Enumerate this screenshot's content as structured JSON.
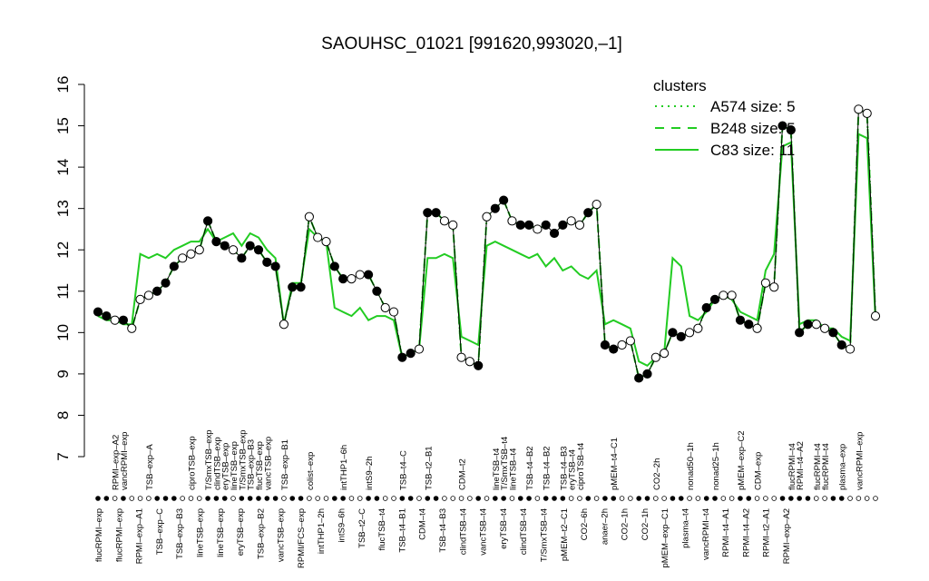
{
  "chart_data": {
    "type": "line",
    "title": "SAOUHSC_01021 [991620,993020,–1]",
    "xlabel": "",
    "ylabel": "",
    "ylim": [
      7,
      16
    ],
    "yticks": [
      7,
      8,
      9,
      10,
      11,
      12,
      13,
      14,
      15,
      16
    ],
    "grid": false,
    "legend": {
      "title": "clusters",
      "placement": "top-right",
      "color": "#22cc22",
      "entries": [
        {
          "label": "A574 size: 5",
          "style": "dotted"
        },
        {
          "label": "B248 size: 5",
          "style": "dashed"
        },
        {
          "label": "C83 size: 11",
          "style": "solid"
        }
      ]
    },
    "top_labels": [
      {
        "i": 2,
        "text": "RPMI–exp–A2"
      },
      {
        "i": 3,
        "text": "vancRPMI–exp"
      },
      {
        "i": 6,
        "text": "TSB–exp–A"
      },
      {
        "i": 11,
        "text": "ciproTSB–exp"
      },
      {
        "i": 13,
        "text": "T/SmxTSB–exp"
      },
      {
        "i": 14,
        "text": "clindTSB–exp"
      },
      {
        "i": 15,
        "text": "eryTSB–exp"
      },
      {
        "i": 16,
        "text": "lineTSB–exp"
      },
      {
        "i": 17,
        "text": "T/SmxTSB–exp"
      },
      {
        "i": 18,
        "text": "TSB–exp–B3"
      },
      {
        "i": 19,
        "text": "flucTSB–exp"
      },
      {
        "i": 20,
        "text": "vancTSB–exp"
      },
      {
        "i": 22,
        "text": "TSB–exp–B1"
      },
      {
        "i": 25,
        "text": "colist–exp"
      },
      {
        "i": 29,
        "text": "intTHP1–6h"
      },
      {
        "i": 32,
        "text": "intS9–2h"
      },
      {
        "i": 36,
        "text": "TSB–t4–C"
      },
      {
        "i": 39,
        "text": "TSB–t2–B1"
      },
      {
        "i": 43,
        "text": "CDM–t2"
      },
      {
        "i": 47,
        "text": "lineTSB–t4"
      },
      {
        "i": 48,
        "text": "T/SmxTSB–t4"
      },
      {
        "i": 49,
        "text": "lineTSB–t4"
      },
      {
        "i": 51,
        "text": "TSB–t4–B2"
      },
      {
        "i": 53,
        "text": "TSB–t4–B2"
      },
      {
        "i": 55,
        "text": "TSB–t4–B3"
      },
      {
        "i": 56,
        "text": "eryTSB–t4"
      },
      {
        "i": 57,
        "text": "ciproTSB–t4"
      },
      {
        "i": 61,
        "text": "pMEM–t4–C1"
      },
      {
        "i": 66,
        "text": "CO2–2h"
      },
      {
        "i": 70,
        "text": "nonad50–1h"
      },
      {
        "i": 73,
        "text": "nonad25–1h"
      },
      {
        "i": 76,
        "text": "pMEM–exp–C2"
      },
      {
        "i": 78,
        "text": "CDM–exp"
      },
      {
        "i": 82,
        "text": "flucRPMI–t4"
      },
      {
        "i": 83,
        "text": "RPMI–t4–A2"
      },
      {
        "i": 85,
        "text": "flucRPMI–t4"
      },
      {
        "i": 86,
        "text": "flucRPMI–t4"
      },
      {
        "i": 88,
        "text": "plasma–exp"
      },
      {
        "i": 90,
        "text": "vancRPMI–exp"
      }
    ],
    "bottom_labels": [
      {
        "i": 0,
        "text": "flucRPMI–exp"
      },
      {
        "i": 1,
        "text": "flucRPMI–exp"
      },
      {
        "i": 2,
        "text": "RPMI–exp–A1"
      },
      {
        "i": 5,
        "text": "TSB–exp–C"
      },
      {
        "i": 9,
        "text": "TSB–exp–B3"
      },
      {
        "i": 10,
        "text": "lineTSB–exp"
      },
      {
        "i": 11,
        "text": "lineTSB–exp"
      },
      {
        "i": 12,
        "text": "eryTSB–exp"
      },
      {
        "i": 13,
        "text": "TSB–exp–B2"
      },
      {
        "i": 14,
        "text": "vancTSB–exp"
      },
      {
        "i": 16,
        "text": "RPMI/FCS–exp"
      },
      {
        "i": 19,
        "text": "intTHP1–2h"
      },
      {
        "i": 22,
        "text": "intS9–6h"
      },
      {
        "i": 25,
        "text": "TSB–t2–C"
      },
      {
        "i": 28,
        "text": "flucTSB–t4"
      },
      {
        "i": 31,
        "text": "TSB–t4–B1"
      },
      {
        "i": 35,
        "text": "CDM–t4"
      },
      {
        "i": 38,
        "text": "TSB–t4–B3"
      },
      {
        "i": 39,
        "text": "clindTSB–t4"
      },
      {
        "i": 40,
        "text": "vancTSB–t4"
      },
      {
        "i": 41,
        "text": "eryTSB–t4"
      },
      {
        "i": 42,
        "text": "clindTSB–t4"
      },
      {
        "i": 43,
        "text": "T/SmxTSB–t4"
      },
      {
        "i": 46,
        "text": "pMEM–t2–C1"
      },
      {
        "i": 50,
        "text": "CO2–6h"
      },
      {
        "i": 54,
        "text": "anaer–2h"
      },
      {
        "i": 57,
        "text": "CO2–1h"
      },
      {
        "i": 60,
        "text": "CO2–1h"
      },
      {
        "i": 64,
        "text": "pMEM–exp–C1"
      },
      {
        "i": 68,
        "text": "plasma–t4"
      },
      {
        "i": 71,
        "text": "vancRPMI–t4"
      },
      {
        "i": 72,
        "text": "RPMI–t4–A1"
      },
      {
        "i": 73,
        "text": "RPMI–t4–A2"
      },
      {
        "i": 76,
        "text": "RPMI–t2–A1"
      },
      {
        "i": 80,
        "text": "RPMI–exp–A2"
      }
    ],
    "series": [
      {
        "style": "dotted",
        "color": "#22cc22",
        "values": [
          10.5,
          10.4,
          10.3,
          10.3,
          10.1,
          10.8,
          10.9,
          11.0,
          11.2,
          11.6,
          11.8,
          11.9,
          12.0,
          12.7,
          12.2,
          12.1,
          12.0,
          11.8,
          12.1,
          12.0,
          11.7,
          11.6,
          10.2,
          11.1,
          11.1,
          12.8,
          12.3,
          12.2,
          11.6,
          11.3,
          11.3,
          11.4,
          11.4,
          11.0,
          10.6,
          10.5,
          9.4,
          9.5,
          9.6,
          12.9,
          12.9,
          12.7,
          12.6,
          9.4,
          9.3,
          9.2,
          12.8,
          13.0,
          13.2,
          12.7,
          12.6,
          12.6,
          12.5,
          12.6,
          12.4,
          12.6,
          12.7,
          12.6,
          12.9,
          13.1,
          9.7,
          9.6,
          9.7,
          9.8,
          8.9,
          9.0,
          9.4,
          9.5,
          10.0,
          9.9,
          10.0,
          10.1,
          10.6,
          10.8,
          10.9,
          10.9,
          10.3,
          10.2,
          10.1,
          11.2,
          11.1,
          15.0,
          14.9,
          10.0,
          10.2,
          10.2,
          10.1,
          10.0,
          9.7,
          9.6,
          15.4,
          15.3,
          10.4
        ]
      },
      {
        "style": "dashed",
        "color": "#22cc22",
        "values": [
          10.5,
          10.4,
          10.3,
          10.3,
          10.1,
          10.8,
          10.9,
          11.0,
          11.2,
          11.6,
          11.8,
          11.9,
          12.0,
          12.7,
          12.2,
          12.1,
          12.0,
          11.8,
          12.1,
          12.0,
          11.7,
          11.6,
          10.2,
          11.1,
          11.1,
          12.8,
          12.3,
          12.2,
          11.6,
          11.3,
          11.3,
          11.4,
          11.4,
          11.0,
          10.6,
          10.5,
          9.4,
          9.5,
          9.6,
          12.9,
          12.9,
          12.7,
          12.6,
          9.4,
          9.3,
          9.2,
          12.8,
          13.0,
          13.2,
          12.7,
          12.6,
          12.6,
          12.5,
          12.6,
          12.4,
          12.6,
          12.7,
          12.6,
          12.9,
          13.1,
          9.7,
          9.6,
          9.7,
          9.8,
          8.9,
          9.0,
          9.4,
          9.5,
          10.0,
          9.9,
          10.0,
          10.1,
          10.6,
          10.8,
          10.9,
          10.9,
          10.3,
          10.2,
          10.1,
          11.2,
          11.1,
          15.0,
          14.9,
          10.0,
          10.2,
          10.2,
          10.1,
          10.0,
          9.7,
          9.6,
          15.4,
          15.3,
          10.4
        ]
      },
      {
        "style": "solid",
        "color": "#22cc22",
        "values": [
          10.4,
          10.3,
          10.3,
          10.2,
          10.2,
          11.9,
          11.8,
          11.9,
          11.8,
          12.0,
          12.1,
          12.2,
          12.2,
          12.5,
          12.2,
          12.3,
          12.4,
          12.1,
          12.4,
          12.3,
          12.0,
          11.8,
          10.2,
          11.2,
          11.2,
          12.5,
          12.3,
          12.2,
          10.6,
          10.5,
          10.4,
          10.6,
          10.3,
          10.4,
          10.4,
          10.3,
          9.4,
          9.5,
          9.6,
          11.8,
          11.8,
          11.9,
          11.8,
          9.9,
          9.8,
          9.7,
          12.1,
          12.2,
          12.1,
          12.0,
          11.9,
          11.8,
          11.9,
          11.6,
          11.8,
          11.5,
          11.6,
          11.4,
          11.3,
          11.5,
          10.2,
          10.3,
          10.2,
          10.1,
          9.3,
          9.2,
          9.4,
          9.5,
          11.8,
          11.6,
          10.4,
          10.3,
          10.5,
          10.8,
          10.9,
          10.8,
          10.5,
          10.4,
          10.3,
          11.5,
          11.9,
          14.5,
          14.6,
          10.2,
          10.3,
          10.3,
          10.1,
          10.1,
          9.9,
          9.8,
          14.8,
          14.7,
          10.3
        ]
      },
      {
        "style": "points",
        "color": "#000000",
        "values": [
          10.5,
          10.4,
          10.3,
          10.3,
          10.1,
          10.8,
          10.9,
          11.0,
          11.2,
          11.6,
          11.8,
          11.9,
          12.0,
          12.7,
          12.2,
          12.1,
          12.0,
          11.8,
          12.1,
          12.0,
          11.7,
          11.6,
          10.2,
          11.1,
          11.1,
          12.8,
          12.3,
          12.2,
          11.6,
          11.3,
          11.3,
          11.4,
          11.4,
          11.0,
          10.6,
          10.5,
          9.4,
          9.5,
          9.6,
          12.9,
          12.9,
          12.7,
          12.6,
          9.4,
          9.3,
          9.2,
          12.8,
          13.0,
          13.2,
          12.7,
          12.6,
          12.6,
          12.5,
          12.6,
          12.4,
          12.6,
          12.7,
          12.6,
          12.9,
          13.1,
          9.7,
          9.6,
          9.7,
          9.8,
          8.9,
          9.0,
          9.4,
          9.5,
          10.0,
          9.9,
          10.0,
          10.1,
          10.6,
          10.8,
          10.9,
          10.9,
          10.3,
          10.2,
          10.1,
          11.2,
          11.1,
          15.0,
          14.9,
          10.0,
          10.2,
          10.2,
          10.1,
          10.0,
          9.7,
          9.6,
          15.4,
          15.3,
          10.4
        ],
        "filled": [
          1,
          1,
          0,
          1,
          0,
          0,
          0,
          1,
          1,
          1,
          0,
          0,
          0,
          1,
          1,
          1,
          0,
          1,
          1,
          1,
          1,
          1,
          0,
          1,
          1,
          0,
          0,
          0,
          1,
          1,
          0,
          0,
          1,
          1,
          0,
          0,
          1,
          1,
          0,
          1,
          1,
          0,
          0,
          0,
          0,
          1,
          0,
          1,
          1,
          0,
          1,
          1,
          0,
          1,
          1,
          1,
          0,
          0,
          1,
          0,
          1,
          1,
          0,
          0,
          1,
          1,
          0,
          0,
          1,
          1,
          0,
          0,
          1,
          1,
          0,
          0,
          1,
          1,
          0,
          0,
          0,
          1,
          1,
          1,
          1,
          0,
          0,
          1,
          1,
          0,
          0,
          0,
          0
        ]
      }
    ]
  }
}
